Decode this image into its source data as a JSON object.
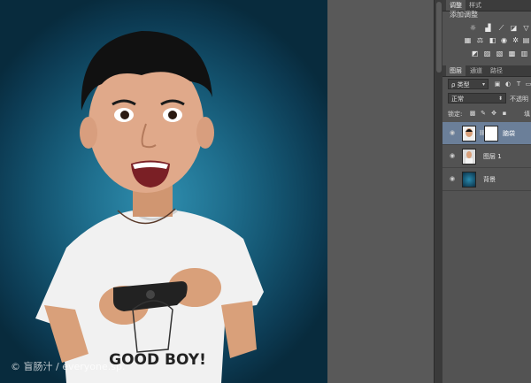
{
  "watermark": "© 盲肠汁 / everyone.sp.",
  "shirt_text": "GOOD BOY!",
  "panels": {
    "top_tabs": [
      {
        "label": "调整",
        "active": true
      },
      {
        "label": "样式",
        "active": false
      }
    ],
    "adjustments": {
      "title": "添加调整",
      "row1_icons": [
        "brightness-icon",
        "levels-icon",
        "curves-icon",
        "exposure-icon",
        "vibrance-icon"
      ],
      "row2_icons": [
        "hue-saturation-icon",
        "color-balance-icon",
        "black-white-icon",
        "photo-filter-icon",
        "channel-mixer-icon",
        "color-lookup-icon"
      ],
      "row3_icons": [
        "invert-icon",
        "posterize-icon",
        "threshold-icon",
        "selective-color-icon",
        "gradient-map-icon"
      ]
    },
    "layer_tabs": [
      {
        "label": "图层",
        "active": true
      },
      {
        "label": "通道",
        "active": false
      },
      {
        "label": "路径",
        "active": false
      }
    ],
    "filter": {
      "label": "ρ 类型"
    },
    "blend_mode": {
      "value": "正常"
    },
    "opacity_label": "不透明",
    "lock_label": "锁定:",
    "fill_label": "填",
    "layers": [
      {
        "name": "脑袋",
        "selected": true
      },
      {
        "name": "图层 1",
        "selected": false
      },
      {
        "name": "背景",
        "selected": false
      }
    ]
  }
}
